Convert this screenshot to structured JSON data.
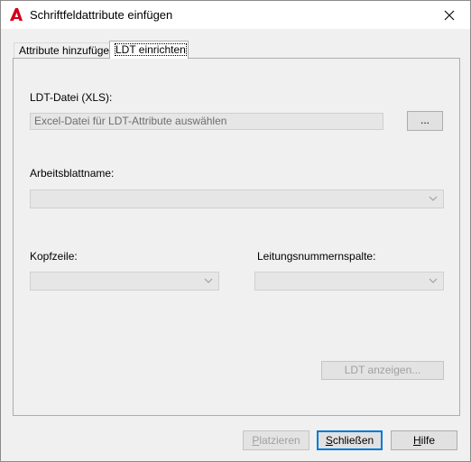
{
  "window": {
    "title": "Schriftfeldattribute einfügen"
  },
  "tabs": [
    {
      "label": "Attribute hinzufügen",
      "active": false
    },
    {
      "label": "LDT einrichten",
      "active": true
    }
  ],
  "ldt": {
    "file_label": "LDT-Datei (XLS):",
    "file_placeholder": "Excel-Datei für LDT-Attribute auswählen",
    "browse_label": "...",
    "sheet_label": "Arbeitsblattname:",
    "header_label": "Kopfzeile:",
    "line_column_label": "Leitungsnummernspalte:",
    "show_button": "LDT anzeigen..."
  },
  "footer": {
    "place_first": "P",
    "place_rest": "latzieren",
    "close_first": "S",
    "close_rest": "chließen",
    "help_first": "H",
    "help_rest": "ilfe"
  },
  "colors": {
    "accent": "#0078d7",
    "app_icon_red": "#d0021b"
  },
  "icons": {
    "app": "autocad-logo-icon",
    "close": "close-icon",
    "dropdown": "chevron-down-icon"
  }
}
